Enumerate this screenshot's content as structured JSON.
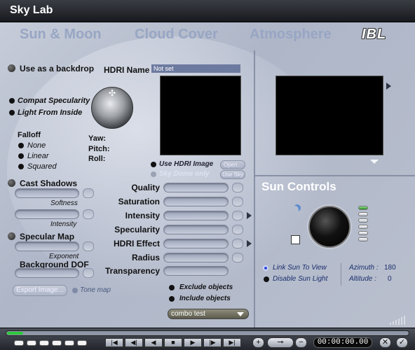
{
  "window": {
    "title": "Sky Lab"
  },
  "tabs": [
    {
      "label": "Sun & Moon",
      "active": false
    },
    {
      "label": "Cloud Cover",
      "active": false
    },
    {
      "label": "Atmosphere",
      "active": false
    },
    {
      "label": "IBL",
      "active": true
    }
  ],
  "ibl": {
    "use_backdrop": "Use as a backdrop",
    "hdri_name_label": "HDRI Name",
    "hdri_name_value": "Not set",
    "compat_specularity": "Compat Specularity",
    "light_from_inside": "Light From Inside",
    "falloff": {
      "label": "Falloff",
      "options": [
        "None",
        "Linear",
        "Squared"
      ]
    },
    "rotation": {
      "yaw": "Yaw:",
      "pitch": "Pitch:",
      "roll": "Roll:"
    },
    "use_hdri_image": "Use HDRI Image",
    "sky_dome_only": "Sky Dome only",
    "open_button": "Open...",
    "use_sky_button": "Use Sky",
    "cast_shadows": "Cast Shadows",
    "softness": "Softness",
    "intensity_small": "Intensity",
    "specular_map": "Specular Map",
    "exponent": "Exponent",
    "background_dof": "Background DOF",
    "export_image": "Export Image...",
    "tone_map": "Tone map",
    "params": [
      "Quality",
      "Saturation",
      "Intensity",
      "Specularity",
      "HDRI Effect",
      "Radius",
      "Transparency"
    ],
    "exclude_objects": "Exclude objects",
    "include_objects": "Include objects",
    "combo_value": "combo test"
  },
  "sun_controls": {
    "title": "Sun Controls",
    "link_sun_to_view": "Link Sun To View",
    "disable_sun_light": "Disable Sun Light",
    "azimuth_label": "Azimuth :",
    "azimuth_value": "180",
    "altitude_label": "Altitude :",
    "altitude_value": "0"
  },
  "timeline": {
    "timecode": "00:00:00.00",
    "progress": 0.04,
    "transport": [
      "|◀",
      "◀|",
      "◀",
      "■",
      "▶",
      "|▶",
      "▶|"
    ],
    "extra": [
      "+",
      "⊸",
      "−",
      "✕",
      "✓"
    ]
  },
  "colors": {
    "accent": "#2cc83a",
    "panel": "#b9bfcd",
    "tab_inactive": "#98a6c4"
  }
}
